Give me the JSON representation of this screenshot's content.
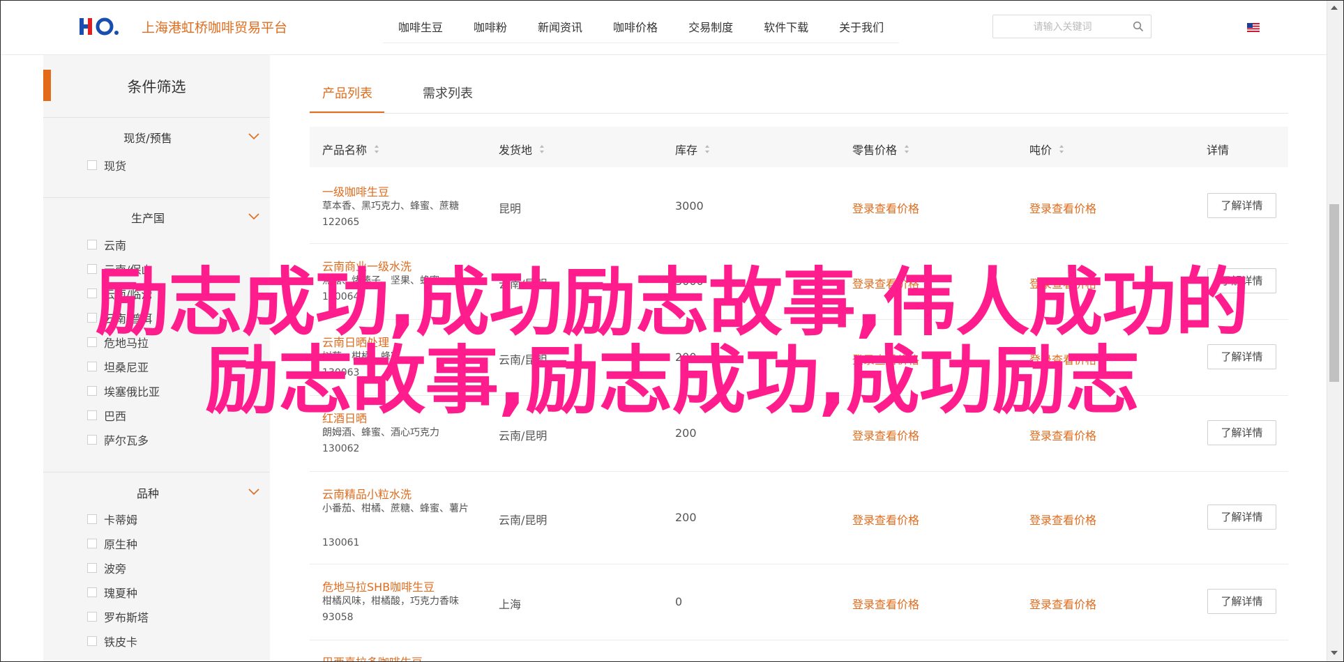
{
  "header": {
    "site_name": "上海港虹桥咖啡贸易平台",
    "nav": [
      "咖啡生豆",
      "咖啡粉",
      "新闻资讯",
      "咖啡价格",
      "交易制度",
      "软件下载",
      "关于我们"
    ],
    "search_placeholder": "请输入关键词"
  },
  "sidebar": {
    "title": "条件筛选",
    "groups": [
      {
        "title": "现货/预售",
        "options": [
          "现货"
        ]
      },
      {
        "title": "生产国",
        "options": [
          "云南",
          "云南/保山",
          "云南/临沧",
          "云南/普洱",
          "危地马拉",
          "坦桑尼亚",
          "埃塞俄比亚",
          "巴西",
          "萨尔瓦多"
        ]
      },
      {
        "title": "品种",
        "options": [
          "卡蒂姆",
          "原生种",
          "波旁",
          "瑰夏种",
          "罗布斯塔",
          "铁皮卡"
        ]
      }
    ]
  },
  "tabs": {
    "active": "产品列表",
    "other": "需求列表"
  },
  "table": {
    "headers": [
      "产品名称",
      "发货地",
      "库存",
      "零售价格",
      "吨价",
      "详情"
    ],
    "price_link": "登录查看价格",
    "detail_label": "了解详情",
    "rows": [
      {
        "name": "一级咖啡生豆",
        "desc": "草本香、黑巧克力、蜂蜜、蔗糖",
        "code": "122065",
        "origin": "昆明",
        "stock": "3000"
      },
      {
        "name": "云南商业一级水洗",
        "desc": "焦糖、烤榛子、坚果、蜂蜜",
        "code": "130064",
        "origin": "云南/昆明",
        "stock": "3000"
      },
      {
        "name": "云南日晒处理",
        "desc": "树莓、柑橘、蜂蜜",
        "code": "130063",
        "origin": "云南/昆明",
        "stock": "200"
      },
      {
        "name": "红酒日晒",
        "desc": "朗姆酒、蜂蜜、酒心巧克力",
        "code": "130062",
        "origin": "云南/昆明",
        "stock": "200"
      },
      {
        "name": "云南精品小粒水洗",
        "desc": "小番茄、柑橘、蔗糖、蜂蜜、薯片",
        "code": "130061",
        "origin": "云南/昆明",
        "stock": "200"
      },
      {
        "name": "危地马拉SHB咖啡生豆",
        "desc": "柑橘风味，柑橘酸，巧克力香味",
        "code": "93058",
        "origin": "上海",
        "stock": "0"
      },
      {
        "name": "巴西喜拉多咖啡生豆",
        "desc": "",
        "code": "",
        "origin": "",
        "stock": ""
      }
    ]
  },
  "overlay": {
    "line1": "励志成功,成功励志故事,伟人成功的",
    "line2": "励志故事,励志成功,成功励志"
  },
  "colors": {
    "accent": "#e06c1e",
    "overlay": "#ff1d8e"
  }
}
